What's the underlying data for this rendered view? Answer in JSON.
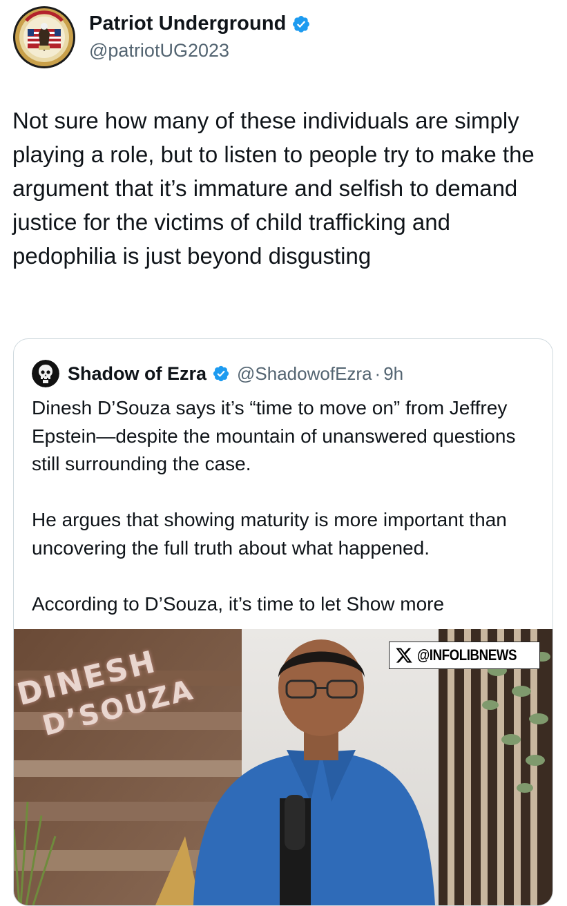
{
  "author": {
    "display_name": "Patriot Underground",
    "handle": "@patriotUG2023",
    "verified": true,
    "avatar_icon": "patriot-seal-icon"
  },
  "tweet": {
    "text": "Not sure how many of these individuals are simply playing a role, but to listen to people try to make the argument that it’s immature and selfish to demand justice for the victims of child trafficking and pedophilia is just beyond disgusting"
  },
  "quoted": {
    "display_name": "Shadow of Ezra",
    "handle": "@ShadowofEzra",
    "separator": "·",
    "time": "9h",
    "verified": true,
    "avatar_icon": "skull-icon",
    "text": "Dinesh D’Souza says it’s “time to move on” from Jeffrey Epstein—despite the mountain of unanswered questions still surrounding the case.\n\nHe argues that showing maturity is more important than uncovering the full truth about what happened.\n\nAccording to D’Souza, it’s time to let ",
    "show_more": "Show more",
    "media": {
      "sign_line1": "DINESH",
      "sign_line2": "D’SOUZA",
      "watermark": "@INFOLIBNEWS"
    }
  },
  "colors": {
    "verified": "#1d9bf0",
    "text": "#0f1419",
    "secondary": "#536471",
    "border": "#cfd9de"
  }
}
